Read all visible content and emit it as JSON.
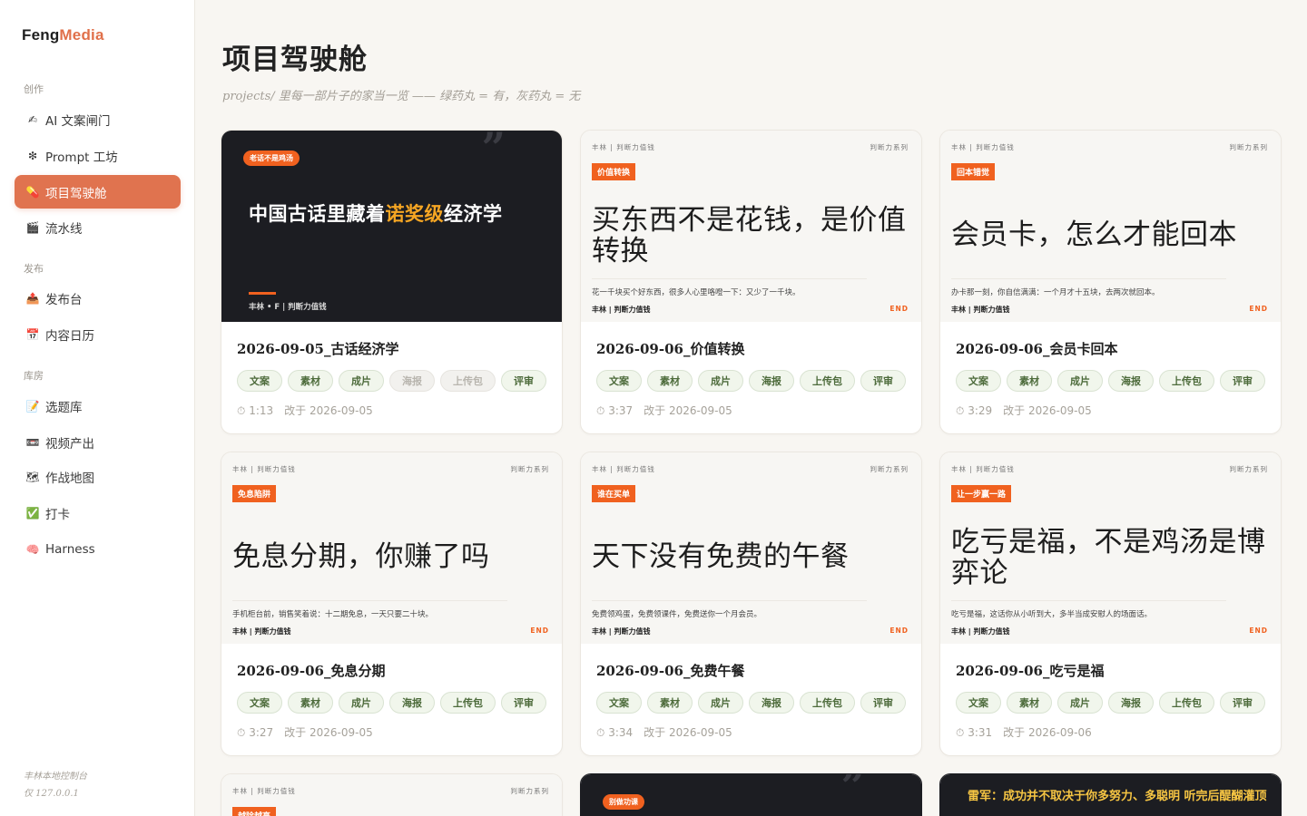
{
  "brand": {
    "part1": "Feng",
    "part2": "Media"
  },
  "sidebar": {
    "sections": [
      {
        "label": "创作"
      },
      {
        "label": "发布"
      },
      {
        "label": "库房"
      }
    ],
    "items": [
      {
        "label": "AI 文案闸门",
        "icon": "✍"
      },
      {
        "label": "Prompt 工坊",
        "icon": "❇"
      },
      {
        "label": "项目驾驶舱",
        "icon": "💊"
      },
      {
        "label": "流水线",
        "icon": "🎬"
      },
      {
        "label": "发布台",
        "icon": "📤"
      },
      {
        "label": "内容日历",
        "icon": "📅"
      },
      {
        "label": "选题库",
        "icon": "📝"
      },
      {
        "label": "视频产出",
        "icon": "📼"
      },
      {
        "label": "作战地图",
        "icon": "🗺"
      },
      {
        "label": "打卡",
        "icon": "✅"
      },
      {
        "label": "Harness",
        "icon": "🧠"
      }
    ],
    "footer": {
      "line1": "丰林本地控制台",
      "line2": "仅 127.0.0.1"
    }
  },
  "page": {
    "title": "项目驾驶舱",
    "subtitle": "projects/ 里每一部片子的家当一览 —— 绿药丸 = 有，灰药丸 = 无"
  },
  "chips_labels": [
    "文案",
    "素材",
    "成片",
    "海报",
    "上传包",
    "评审"
  ],
  "cards": [
    {
      "thumb": {
        "pill": "老话不是鸡汤",
        "head_a": "中国古话里藏着",
        "head_hl": "诺奖级",
        "head_b": "经济学",
        "foot": "丰林 • F | 判断力值钱",
        "quote": "”"
      },
      "title": "2026-09-05_古话经济学",
      "chips_on": [
        true,
        true,
        true,
        false,
        false,
        true
      ],
      "duration": "1:13",
      "modified": "改于 2026-09-05"
    },
    {
      "thumb": {
        "top_left": "丰林 | 判断力值钱",
        "top_right": "判断力系列",
        "tag": "价值转换",
        "headline": "买东西不是花钱，是价值转换",
        "desc": "花一千块买个好东西，很多人心里咯噔一下：又少了一千块。",
        "foot": "丰林 | 判断力值钱",
        "end": "END"
      },
      "title": "2026-09-06_价值转换",
      "chips_on": [
        true,
        true,
        true,
        true,
        true,
        true
      ],
      "duration": "3:37",
      "modified": "改于 2026-09-05"
    },
    {
      "thumb": {
        "top_left": "丰林 | 判断力值钱",
        "top_right": "判断力系列",
        "tag": "回本错觉",
        "headline": "会员卡，怎么才能回本",
        "desc": "办卡那一刻，你自信满满：一个月才十五块，去两次就回本。",
        "foot": "丰林 | 判断力值钱",
        "end": "END"
      },
      "title": "2026-09-06_会员卡回本",
      "chips_on": [
        true,
        true,
        true,
        true,
        true,
        true
      ],
      "duration": "3:29",
      "modified": "改于 2026-09-05"
    },
    {
      "thumb": {
        "top_left": "丰林 | 判断力值钱",
        "top_right": "判断力系列",
        "tag": "免息陷阱",
        "headline": "免息分期，你赚了吗",
        "desc": "手机柜台前，销售笑着说：十二期免息，一天只要二十块。",
        "foot": "丰林 | 判断力值钱",
        "end": "END"
      },
      "title": "2026-09-06_免息分期",
      "chips_on": [
        true,
        true,
        true,
        true,
        true,
        true
      ],
      "duration": "3:27",
      "modified": "改于 2026-09-05"
    },
    {
      "thumb": {
        "top_left": "丰林 | 判断力值钱",
        "top_right": "判断力系列",
        "tag": "谁在买单",
        "headline": "天下没有免费的午餐",
        "desc": "免费领鸡蛋，免费领课件，免费送你一个月会员。",
        "foot": "丰林 | 判断力值钱",
        "end": "END"
      },
      "title": "2026-09-06_免费午餐",
      "chips_on": [
        true,
        true,
        true,
        true,
        true,
        true
      ],
      "duration": "3:34",
      "modified": "改于 2026-09-05"
    },
    {
      "thumb": {
        "top_left": "丰林 | 判断力值钱",
        "top_right": "判断力系列",
        "tag": "让一步赢一路",
        "headline": "吃亏是福，不是鸡汤是博弈论",
        "desc": "吃亏是福，这话你从小听到大，多半当成安慰人的场面话。",
        "foot": "丰林 | 判断力值钱",
        "end": "END"
      },
      "title": "2026-09-06_吃亏是福",
      "chips_on": [
        true,
        true,
        true,
        true,
        true,
        true
      ],
      "duration": "3:31",
      "modified": "改于 2026-09-06"
    }
  ],
  "row3": {
    "light": {
      "top_left": "丰林 | 判断力值钱",
      "top_right": "判断力系列",
      "tag": "越除越亮"
    },
    "dark": {
      "pill": "别做功课",
      "quote": "”"
    },
    "banner": {
      "text": "雷军：成功并不取决于你多努力、多聪明 听完后醍醐灌顶"
    }
  },
  "colors": {
    "accent": "#e0734f",
    "orange": "#f0611f",
    "chip_green_bg": "#f1f6ec",
    "chip_green_text": "#4d6b3b",
    "chip_gray_text": "#b8b5ae"
  }
}
